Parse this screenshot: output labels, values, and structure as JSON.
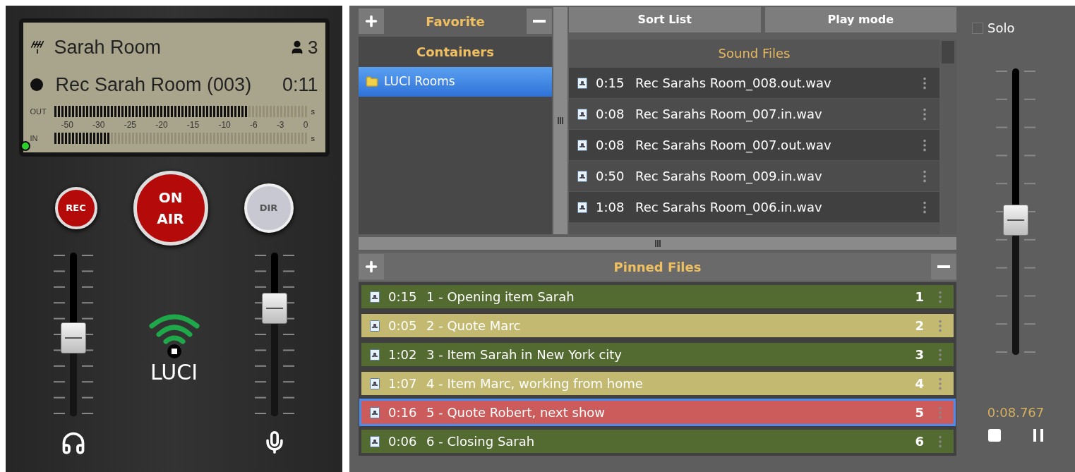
{
  "station": {
    "room": "Sarah Room",
    "listeners": "3",
    "recording": "Rec Sarah Room (003)",
    "elapsed": "0:11",
    "meters": [
      {
        "label": "OUT",
        "level": 0.76,
        "unit": "s"
      },
      {
        "label": "IN",
        "level": 0.22,
        "unit": "s"
      }
    ],
    "scale": [
      "-50",
      "-30",
      "-25",
      "-20",
      "-15",
      "-10",
      "-6",
      "-3",
      "0"
    ]
  },
  "buttons": [
    {
      "label": "REC",
      "kind": "rec"
    },
    {
      "label": "ON AIR",
      "kind": "onair"
    },
    {
      "label": "DIR",
      "kind": "dir"
    }
  ],
  "logo": "LUCI",
  "faders": [
    {
      "kind": "headphones",
      "level": 0.48
    },
    {
      "kind": "microphone",
      "level": 0.66
    }
  ],
  "favorites": {
    "title": "Favorite",
    "containers_title": "Containers",
    "containers": [
      {
        "label": "LUCI Rooms",
        "selected": true
      }
    ]
  },
  "sound_files": {
    "sort": "Sort List",
    "play_mode": "Play mode",
    "title": "Sound Files",
    "files": [
      {
        "duration": "0:15",
        "name": "Rec Sarahs Room_008.out.wav"
      },
      {
        "duration": "0:08",
        "name": "Rec Sarahs Room_007.in.wav"
      },
      {
        "duration": "0:08",
        "name": "Rec Sarahs Room_007.out.wav"
      },
      {
        "duration": "0:50",
        "name": "Rec Sarahs Room_009.in.wav"
      },
      {
        "duration": "1:08",
        "name": "Rec Sarahs Room_006.in.wav"
      }
    ]
  },
  "pinned": {
    "title": "Pinned Files",
    "files": [
      {
        "duration": "0:15",
        "name": "1 - Opening item Sarah",
        "number": "1",
        "color": "#536a30",
        "selected": false
      },
      {
        "duration": "0:05",
        "name": "2 - Quote Marc",
        "number": "2",
        "color": "#c4b970",
        "selected": false
      },
      {
        "duration": "1:02",
        "name": "3 - Item Sarah in New York city",
        "number": "3",
        "color": "#536a30",
        "selected": false
      },
      {
        "duration": "1:07",
        "name": "4 - Item Marc, working from home",
        "number": "4",
        "color": "#c4b970",
        "selected": false
      },
      {
        "duration": "0:16",
        "name": "5 - Quote Robert, next show",
        "number": "5",
        "color": "#cc5b5b",
        "selected": true
      },
      {
        "duration": "0:06",
        "name": "6 - Closing Sarah",
        "number": "6",
        "color": "#536a30",
        "selected": false
      }
    ]
  },
  "player": {
    "solo": {
      "label": "Solo",
      "checked": false
    },
    "level": 0.47,
    "time": "0:08.767"
  }
}
